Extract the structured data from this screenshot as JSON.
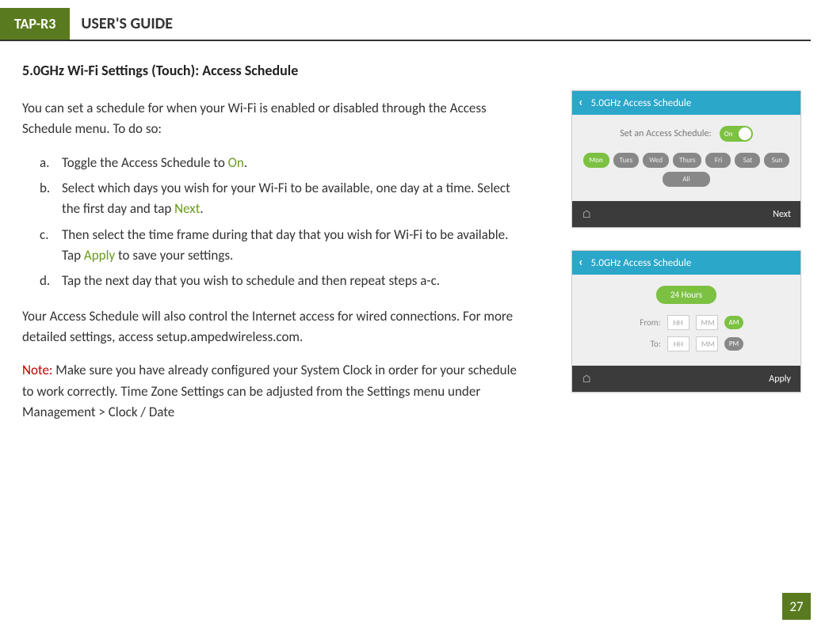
{
  "header": {
    "badge": "TAP-R3",
    "title": "USER'S GUIDE"
  },
  "section_title": "5.0GHz Wi-Fi Settings (Touch): Access Schedule",
  "intro": "You can set a schedule for when your Wi-Fi is enabled or disabled through the Access Schedule menu. To do so:",
  "steps": {
    "a": {
      "marker": "a.",
      "pre": "Toggle the Access Schedule to ",
      "green": "On",
      "post": "."
    },
    "b": {
      "marker": "b.",
      "pre": "Select which days you wish for your Wi-Fi to be available, one day at a time. Select the first day and tap ",
      "green": "Next",
      "post": "."
    },
    "c": {
      "marker": "c.",
      "pre": "Then select the time frame during that day that you wish for Wi-Fi to be available. Tap ",
      "green": "Apply",
      "post": " to save your settings."
    },
    "d": {
      "marker": "d.",
      "text": "Tap the next day that you wish to schedule and then repeat steps a-c."
    }
  },
  "para2": "Your Access Schedule will also control the Internet access for wired connections. For more detailed settings, access setup.ampedwireless.com.",
  "note": {
    "label": "Note:",
    "text": "  Make sure you have already configured your System Clock in order for your schedule to work correctly.  Time Zone Settings can be adjusted from the Settings menu under Management > Clock / Date"
  },
  "screen1": {
    "title": "5.0GHz Access Schedule",
    "toggle_label": "Set an Access Schedule:",
    "toggle_value": "On",
    "days": [
      "Mon",
      "Tues",
      "Wed",
      "Thurs",
      "Fri",
      "Sat",
      "Sun",
      "All"
    ],
    "footer_btn": "Next"
  },
  "screen2": {
    "title": "5.0GHz Access Schedule",
    "hours_pill": "24 Hours",
    "from_label": "From:",
    "to_label": "To:",
    "hh": "HH",
    "mm": "MM",
    "am": "AM",
    "pm": "PM",
    "footer_btn": "Apply"
  },
  "page_number": "27"
}
